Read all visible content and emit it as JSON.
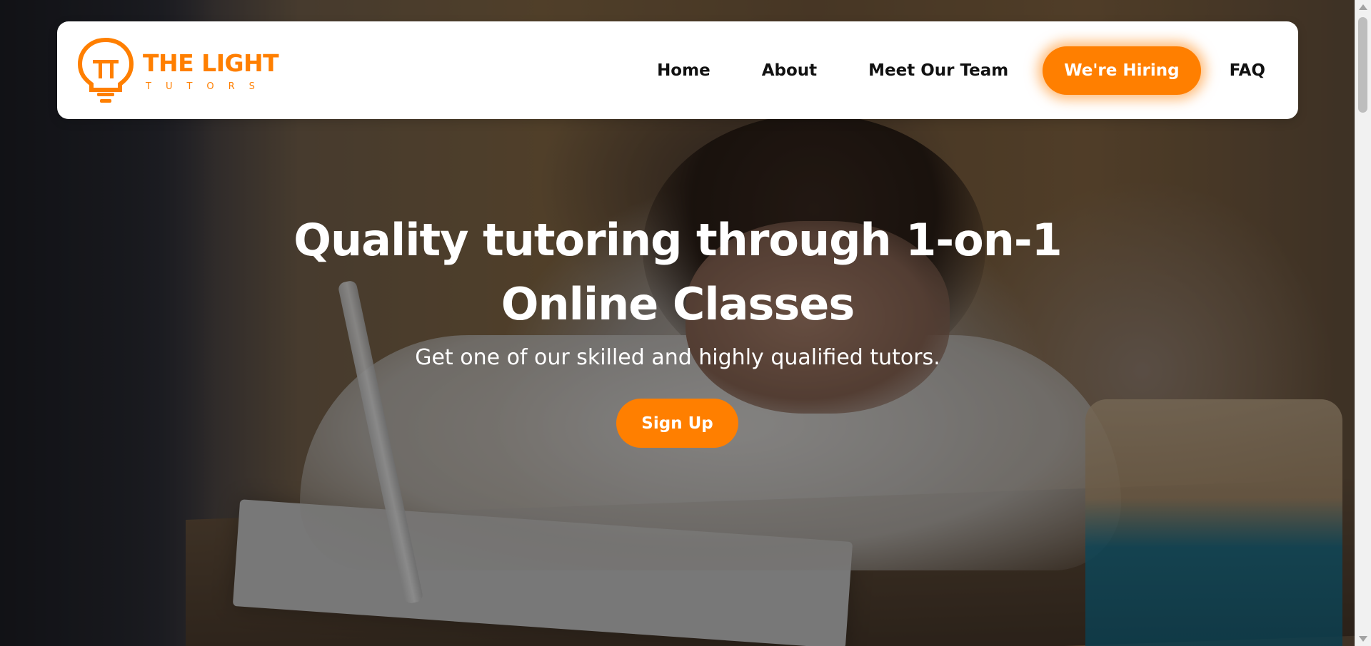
{
  "brand": {
    "name": "THE LIGHT",
    "tagline": "TUTORS",
    "accent_color": "#ff7f00"
  },
  "nav": {
    "items": [
      {
        "label": "Home"
      },
      {
        "label": "About"
      },
      {
        "label": "Meet Our Team"
      },
      {
        "label": "We're Hiring",
        "highlighted": true
      },
      {
        "label": "FAQ"
      }
    ]
  },
  "hero": {
    "headline": "Quality tutoring through 1-on-1 Online Classes",
    "subheadline": "Get one of our skilled and highly qualified tutors.",
    "cta_label": "Sign Up",
    "background_image": "girl writing in notebook at desk"
  },
  "icons": {
    "logo": "lightbulb-icon"
  }
}
